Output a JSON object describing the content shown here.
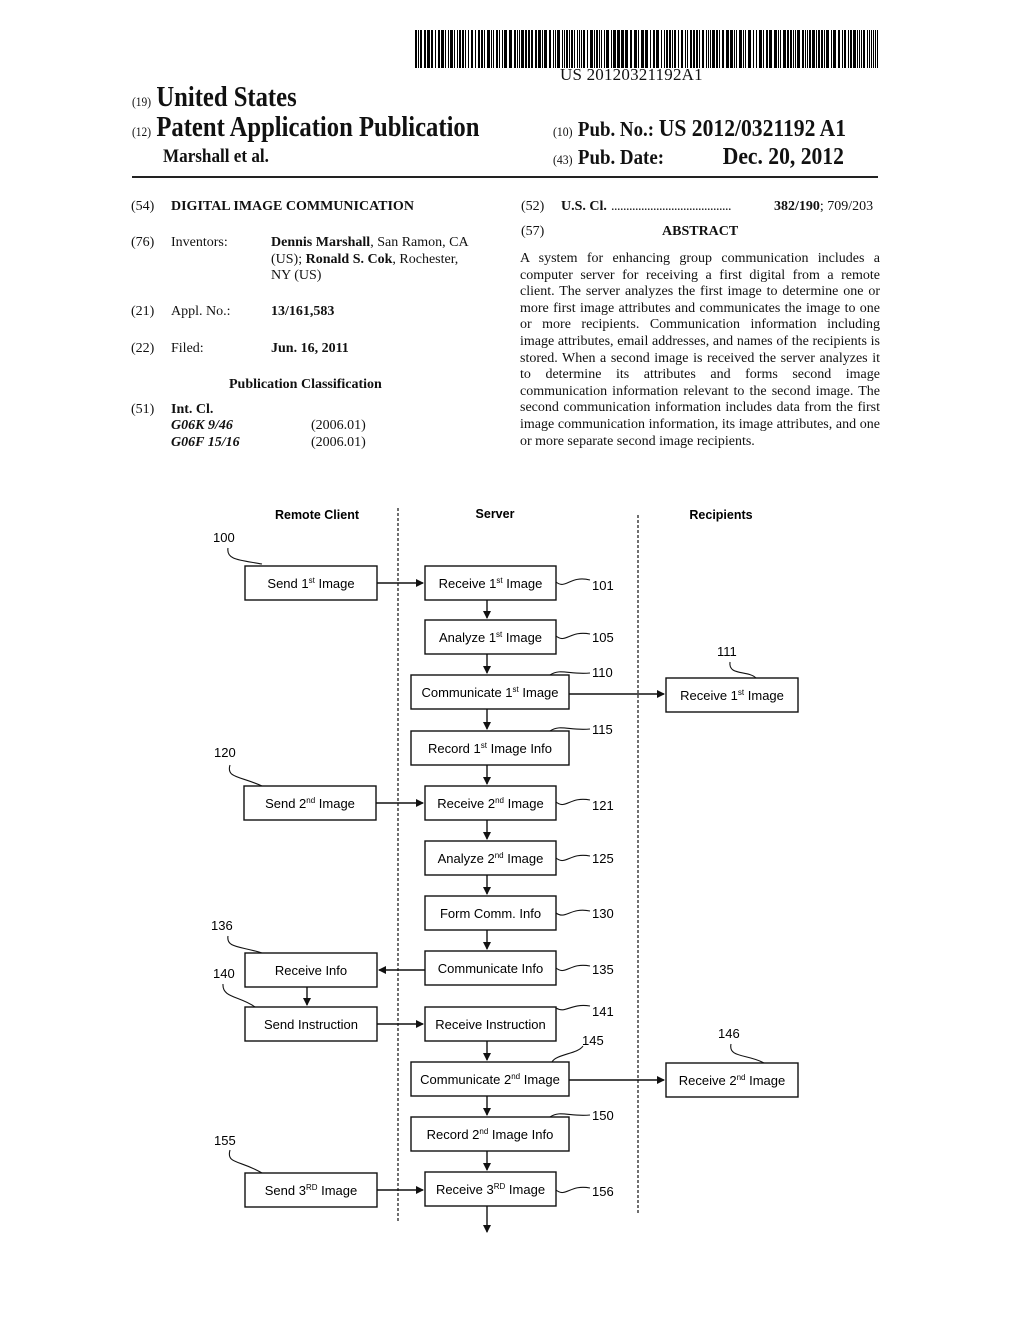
{
  "header": {
    "barcode_number": "US 20120321192A1",
    "country_code": "(19)",
    "country": "United States",
    "type_code": "(12)",
    "type": "Patent Application Publication",
    "authors": "Marshall et al.",
    "pub_no_code": "(10)",
    "pub_no_label": "Pub. No.:",
    "pub_no": "US 2012/0321192 A1",
    "pub_date_code": "(43)",
    "pub_date_label": "Pub. Date:",
    "pub_date": "Dec. 20, 2012"
  },
  "biblio": {
    "title_code": "(54)",
    "title": "DIGITAL IMAGE COMMUNICATION",
    "inventors_code": "(76)",
    "inventors_label": "Inventors:",
    "inventor1_name": "Dennis Marshall",
    "inventor1_loc": ", San Ramon, CA",
    "inventor2_prefix": "(US); ",
    "inventor2_name": "Ronald S. Cok",
    "inventor2_loc": ", Rochester,",
    "inventor2_loc2": "NY (US)",
    "appl_code": "(21)",
    "appl_label": "Appl. No.:",
    "appl_no": "13/161,583",
    "filed_code": "(22)",
    "filed_label": "Filed:",
    "filed_date": "Jun. 16, 2011",
    "pub_class_heading": "Publication Classification",
    "int_cl_code": "(51)",
    "int_cl_label": "Int. Cl.",
    "int_cl": [
      {
        "class": "G06K 9/46",
        "version": "(2006.01)"
      },
      {
        "class": "G06F 15/16",
        "version": "(2006.01)"
      }
    ],
    "us_cl_code": "(52)",
    "us_cl_label": "U.S. Cl.",
    "us_cl_dots": "........................................",
    "us_cl_primary": "382/190",
    "us_cl_secondary": "; 709/203",
    "abstract_code": "(57)",
    "abstract_heading": "ABSTRACT",
    "abstract_text": "A system for enhancing group communication includes a computer server for receiving a first digital from a remote client. The server analyzes the first image to determine one or more first image attributes and communicates the image to one or more recipients. Communication information including image attributes, email addresses, and names of the recipients is stored. When a second image is received the server analyzes it to determine its attributes and forms second image communication information relevant to the second image. The second communication information includes data from the first image communication information, its image attributes, and one or more separate second image recipients."
  },
  "diagram": {
    "lanes": [
      "Remote Client",
      "Server",
      "Recipients"
    ],
    "boxes": [
      {
        "id": "send1",
        "pre": "Send 1",
        "sup": "st",
        "post": " Image",
        "ref": "100"
      },
      {
        "id": "recv1",
        "pre": "Receive 1",
        "sup": "st",
        "post": " Image",
        "ref": "101"
      },
      {
        "id": "analyze1",
        "pre": "Analyze 1",
        "sup": "st",
        "post": " Image",
        "ref": "105"
      },
      {
        "id": "comm1",
        "pre": "Communicate 1",
        "sup": "st",
        "post": " Image",
        "ref": "110"
      },
      {
        "id": "rrecv1",
        "pre": "Receive 1",
        "sup": "st",
        "post": " Image",
        "ref": "111"
      },
      {
        "id": "record1",
        "pre": "Record 1",
        "sup": "st",
        "post": " Image Info",
        "ref": "115"
      },
      {
        "id": "send2",
        "pre": "Send 2",
        "sup": "nd",
        "post": " Image",
        "ref": "120"
      },
      {
        "id": "recv2",
        "pre": "Receive 2",
        "sup": "nd",
        "post": " Image",
        "ref": "121"
      },
      {
        "id": "analyze2",
        "pre": "Analyze 2",
        "sup": "nd",
        "post": " Image",
        "ref": "125"
      },
      {
        "id": "form",
        "pre": "Form Comm. Info",
        "sup": "",
        "post": "",
        "ref": "130"
      },
      {
        "id": "comminfo",
        "pre": "Communicate Info",
        "sup": "",
        "post": "",
        "ref": "135"
      },
      {
        "id": "recvinfo",
        "pre": "Receive Info",
        "sup": "",
        "post": "",
        "ref": "136"
      },
      {
        "id": "sendinstr",
        "pre": "Send Instruction",
        "sup": "",
        "post": "",
        "ref": "140"
      },
      {
        "id": "recvinstr",
        "pre": "Receive Instruction",
        "sup": "",
        "post": "",
        "ref": "141"
      },
      {
        "id": "comm2",
        "pre": "Communicate 2",
        "sup": "nd",
        "post": " Image",
        "ref": "145"
      },
      {
        "id": "rrecv2",
        "pre": "Receive 2",
        "sup": "nd",
        "post": " Image",
        "ref": "146"
      },
      {
        "id": "record2",
        "pre": "Record 2",
        "sup": "nd",
        "post": " Image Info",
        "ref": "150"
      },
      {
        "id": "send3",
        "pre": "Send 3",
        "sup": "RD",
        "post": " Image",
        "ref": "155"
      },
      {
        "id": "recv3",
        "pre": "Receive 3",
        "sup": "RD",
        "post": " Image",
        "ref": "156"
      }
    ]
  }
}
